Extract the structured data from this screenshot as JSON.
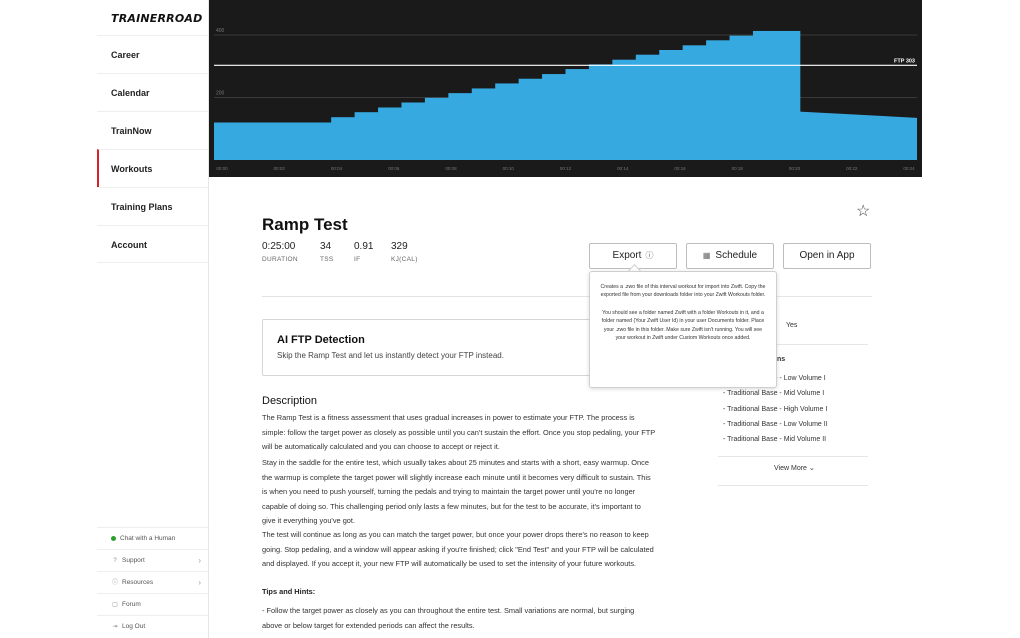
{
  "brand": {
    "logo": "TRAINERROAD"
  },
  "sidebar": {
    "items": [
      {
        "label": "Career"
      },
      {
        "label": "Calendar"
      },
      {
        "label": "TrainNow"
      },
      {
        "label": "Workouts"
      },
      {
        "label": "Training Plans"
      },
      {
        "label": "Account"
      }
    ],
    "bottom": [
      {
        "label": "Chat with a Human"
      },
      {
        "label": "Support"
      },
      {
        "label": "Resources"
      },
      {
        "label": "Forum"
      },
      {
        "label": "Log Out"
      }
    ]
  },
  "chart_data": {
    "type": "area",
    "yticks": [
      "400",
      "200"
    ],
    "ylim": [
      0,
      480
    ],
    "ftp_label": "FTP 303",
    "ftp_value": 303,
    "xticks": [
      "00:00",
      "00:02",
      "00:04",
      "00:06",
      "00:08",
      "00:10",
      "00:12",
      "00:14",
      "00:16",
      "00:18",
      "00:20",
      "00:22",
      "00:24"
    ],
    "xlim": [
      0,
      25
    ],
    "segments": [
      {
        "start": 0,
        "end": 3,
        "watts": 120
      },
      {
        "start": 3,
        "end": 5,
        "watts": 120
      },
      {
        "start": 5,
        "end": 6,
        "watts": 137
      },
      {
        "start": 6,
        "end": 7,
        "watts": 153
      },
      {
        "start": 7,
        "end": 8,
        "watts": 168
      },
      {
        "start": 8,
        "end": 9,
        "watts": 184
      },
      {
        "start": 9,
        "end": 10,
        "watts": 199
      },
      {
        "start": 10,
        "end": 11,
        "watts": 214
      },
      {
        "start": 11,
        "end": 12,
        "watts": 229
      },
      {
        "start": 12,
        "end": 13,
        "watts": 245
      },
      {
        "start": 13,
        "end": 14,
        "watts": 260
      },
      {
        "start": 14,
        "end": 15,
        "watts": 275
      },
      {
        "start": 15,
        "end": 16,
        "watts": 291
      },
      {
        "start": 16,
        "end": 17,
        "watts": 306
      },
      {
        "start": 17,
        "end": 18,
        "watts": 321
      },
      {
        "start": 18,
        "end": 19,
        "watts": 337
      },
      {
        "start": 19,
        "end": 20,
        "watts": 352
      },
      {
        "start": 20,
        "end": 21,
        "watts": 367
      },
      {
        "start": 21,
        "end": 22,
        "watts": 383
      },
      {
        "start": 22,
        "end": 23,
        "watts": 398
      },
      {
        "start": 23,
        "end": 25,
        "watts": 413
      }
    ],
    "cooldown": {
      "start": 25,
      "end": 30,
      "from_watts": 155,
      "to_watts": 135
    },
    "colors": {
      "fill": "#36a9e1",
      "background": "#1a1a1a",
      "ftp_line": "#ffffff"
    }
  },
  "workout": {
    "title": "Ramp Test",
    "stats": [
      {
        "value": "0:25:00",
        "label": "DURATION"
      },
      {
        "value": "34",
        "label": "TSS"
      },
      {
        "value": "0.91",
        "label": "IF"
      },
      {
        "value": "329",
        "label": "KJ(CAL)"
      }
    ]
  },
  "actions": {
    "export": "Export",
    "schedule": "Schedule",
    "open_in_app": "Open in App"
  },
  "tooltip": {
    "p1": "Creates a .zwo file of this interval workout for import into Zwift. Copy the exported file from your downloads folder into your Zwift Workouts folder.",
    "p2": "You should see a folder named Zwift with a folder Workouts in it, and a folder named (Your Zwift User Id) in your user Documents folder. Place your .zwo file in this folder. Make sure Zwift isn't running. You will see your workout in Zwift under Custom Workouts once added."
  },
  "ai": {
    "title": "AI FTP Detection",
    "subtitle": "Skip the Ramp Test and let us instantly detect your FTP instead."
  },
  "side": {
    "yes": "Yes",
    "heading_tail": "ns",
    "plans": [
      "- Traditional Base - Low Volume I",
      "- Traditional Base - Mid Volume I",
      "- Traditional Base - High Volume I",
      "- Traditional Base - Low Volume II",
      "- Traditional Base - Mid Volume II"
    ],
    "view_more": "View More"
  },
  "description": {
    "heading": "Description",
    "p1": "The Ramp Test is a fitness assessment that uses gradual increases in power to estimate your FTP. The process is simple: follow the target power as closely as possible until you can't sustain the effort. Once you stop pedaling, your FTP will be automatically calculated and you can choose to accept or reject it.",
    "p2": "Stay in the saddle for the entire test, which usually takes about 25 minutes and starts with a short, easy warmup. Once the warmup is complete the target power will slightly increase each minute until it becomes very difficult to sustain. This is when you need to push yourself, turning the pedals and trying to maintain the target power until you're no longer capable of doing so. This challenging period only lasts a few minutes, but for the test to be accurate, it's important to give it everything you've got.",
    "p3": "The test will continue as long as you can match the target power, but once your power drops there's no reason to keep going. Stop pedaling, and a window will appear asking if you're finished; click \"End Test\" and your FTP will be calculated and displayed. If you accept it, your new FTP will automatically be used to set the intensity of your future workouts.",
    "tips_heading": "Tips and Hints:",
    "tip1": "- Follow the target power as closely as you can throughout the entire test. Small variations are normal, but surging above or below target for extended periods can affect the results."
  }
}
